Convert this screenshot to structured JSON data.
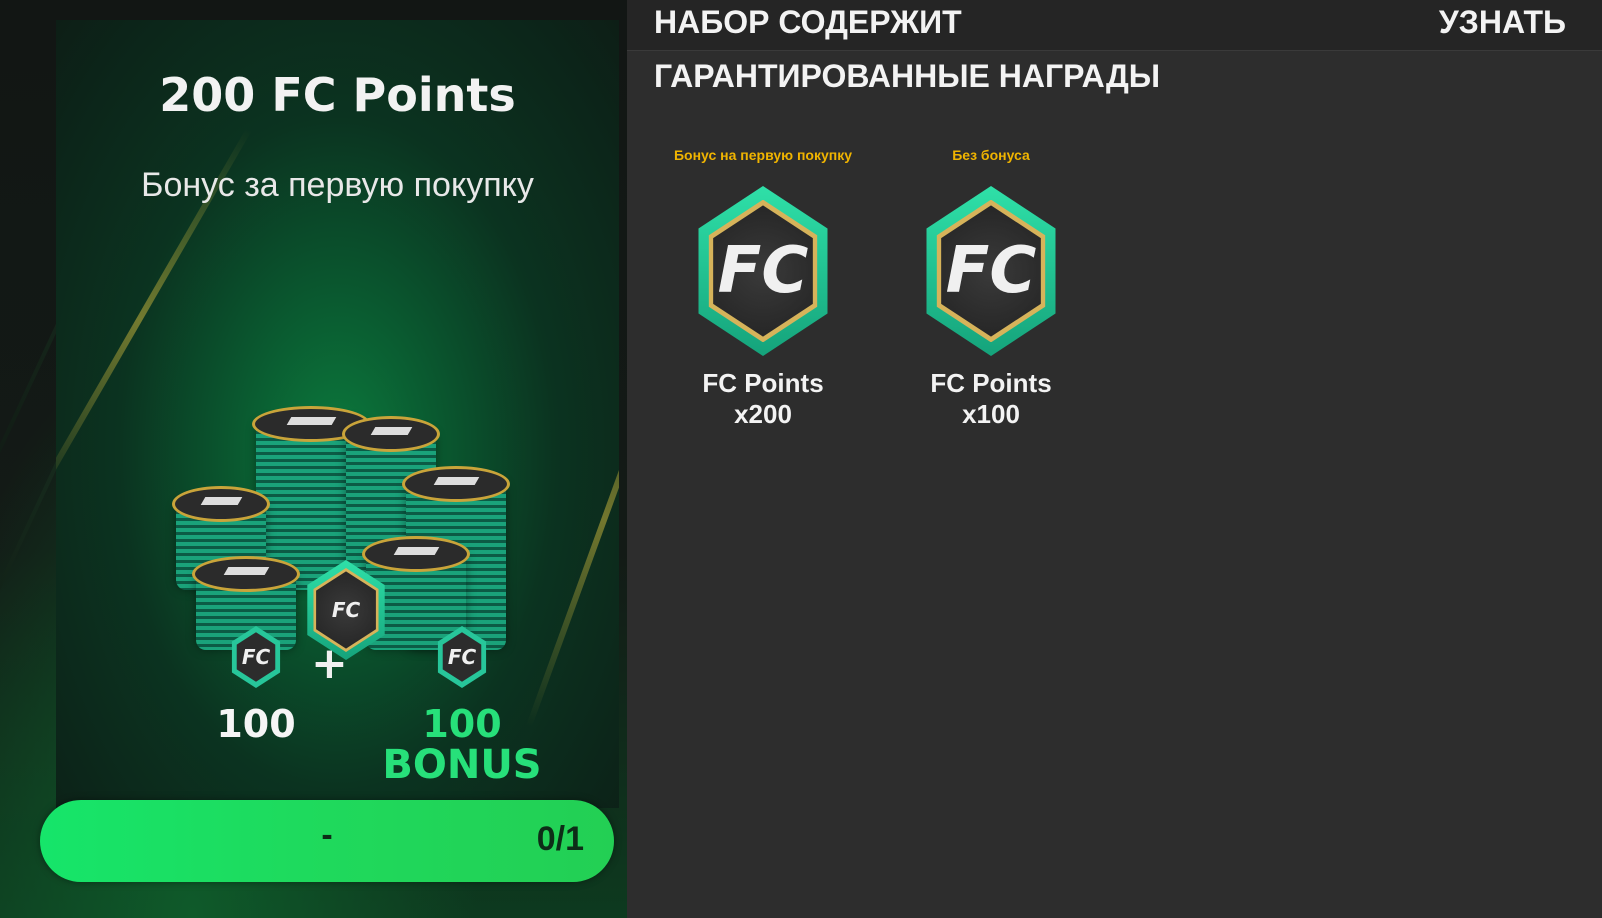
{
  "pack": {
    "title": "200 FC Points",
    "subtitle": "Бонус за первую покупку",
    "base_amount": "100",
    "bonus_amount": "100",
    "bonus_label": "BONUS",
    "price_label": "-",
    "purchase_limit": "0/1"
  },
  "panel": {
    "contents_title": "НАБОР СОДЕРЖИТ",
    "learn_label": "УЗНАТЬ",
    "guaranteed_title": "ГАРАНТИРОВАННЫЕ НАГРАДЫ"
  },
  "rewards": [
    {
      "tag": "Бонус на первую покупку",
      "name": "FC Points",
      "qty": "x200",
      "icon": "fc-points-icon"
    },
    {
      "tag": "Без бонуса",
      "name": "FC Points",
      "qty": "x100",
      "icon": "fc-points-icon"
    }
  ],
  "colors": {
    "accent_green": "#1fd95c",
    "bonus_green": "#27e07a",
    "tag_gold": "#f0b400",
    "panel_bg": "#2d2d2d"
  }
}
